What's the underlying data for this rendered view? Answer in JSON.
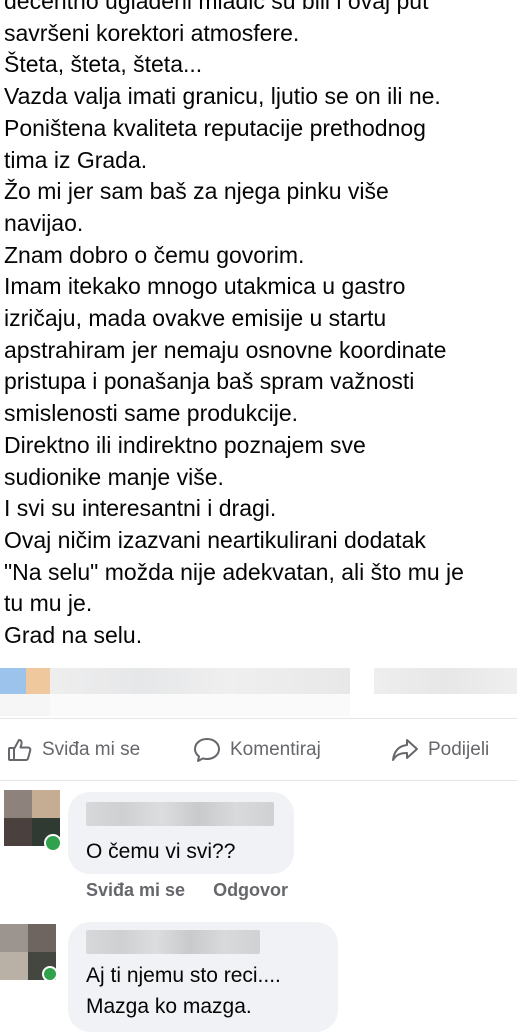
{
  "post": {
    "lines": [
      "decentno uglađeni mladić su bili i ovaj put",
      "savršeni korektori atmosfere.",
      "Šteta, šteta, šteta...",
      "Vazda  valja imati granicu, ljutio se on ili ne.",
      "Poništena kvaliteta reputacije prethodnog",
      "tima iz Grada.",
      "Žo mi jer sam baš za njega pinku više",
      "navijao.",
      "Znam dobro o čemu govorim.",
      "Imam itekako mnogo utakmica u gastro",
      "izričaju, mada ovakve emisije u startu",
      "apstrahiram jer nemaju osnovne koordinate",
      "pristupa i ponašanja baš spram  važnosti",
      "smislenosti same produkcije.",
      "Direktno ili indirektno poznajem sve",
      "sudionike manje više.",
      "I svi su interesantni i dragi.",
      "Ovaj  ničim izazvani neartikulirani dodatak",
      "\"Na selu\" možda nije adekvatan, ali što mu je",
      "tu mu je.",
      "Grad na selu."
    ]
  },
  "actions": {
    "like_label": "Sviđa mi se",
    "comment_label": "Komentiraj",
    "share_label": "Podijeli",
    "like_icon": "thumbs-up-icon",
    "comment_icon": "speech-bubble-icon",
    "share_icon": "share-arrow-icon"
  },
  "comments": [
    {
      "text_lines": [
        "O čemu vi svi??"
      ],
      "like_label": "Sviđa mi se",
      "reply_label": "Odgovor"
    },
    {
      "text_lines": [
        "Aj ti njemu sto reci....",
        "Mazga ko mazga."
      ]
    }
  ],
  "colors": {
    "text": "#050505",
    "secondary": "#65676b",
    "bubble": "#f0f2f5",
    "online": "#31a24c"
  }
}
